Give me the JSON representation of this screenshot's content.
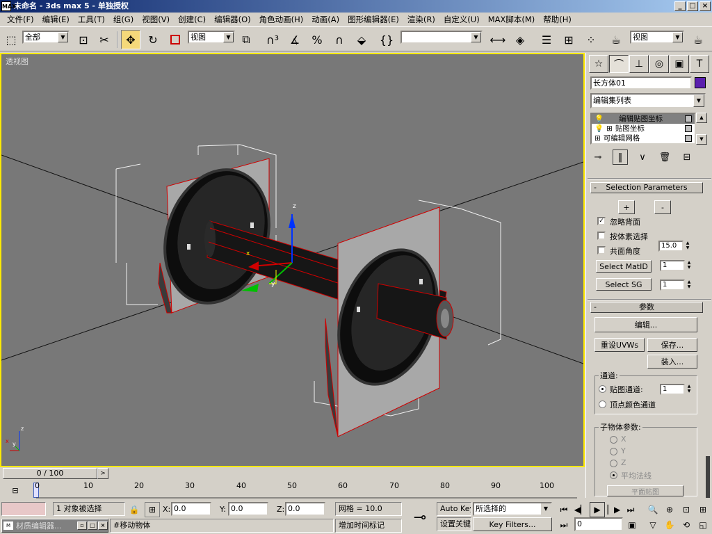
{
  "window": {
    "title": "未命名 - 3ds max 5 - 单独授权",
    "app_icon": "MAX"
  },
  "menu": [
    "文件(F)",
    "编辑(E)",
    "工具(T)",
    "组(G)",
    "视图(V)",
    "创建(C)",
    "编辑器(O)",
    "角色动画(H)",
    "动画(A)",
    "图形编辑器(E)",
    "渲染(R)",
    "自定义(U)",
    "MAX脚本(M)",
    "帮助(H)"
  ],
  "toolbar": {
    "selection_filter": "全部",
    "ref_coord": "视图",
    "named_selection": "",
    "render_view": "视图"
  },
  "viewport": {
    "label": "透视图",
    "gizmo_axis_z": "z",
    "gizmo_axis_x": "x",
    "gizmo_axis_y": "y",
    "corner_axis_z": "z",
    "corner_axis_x": "x",
    "corner_axis_y": "y"
  },
  "panel": {
    "object_name": "长方体01",
    "object_color": "#5a1fae",
    "modifier_list": "编辑集列表",
    "stack": [
      "编辑贴图坐标",
      "贴图坐标",
      "可编辑网格"
    ],
    "selection_params": {
      "title": "Selection Parameters",
      "plus": "+",
      "minus": "-",
      "ignore_backfacing": "忽略背面",
      "by_element": "按体素选择",
      "planar_angle": "共面角度",
      "planar_angle_value": "15.0",
      "select_matid": "Select MatID",
      "select_matid_value": "1",
      "select_sg": "Select SG",
      "select_sg_value": "1"
    },
    "params": {
      "title": "参数",
      "edit": "编辑...",
      "reset_uvws": "重设UVWs",
      "save": "保存...",
      "load": "装入...",
      "channel_group": "通道:",
      "map_channel": "贴图通道:",
      "map_channel_value": "1",
      "vertex_color_channel": "顶点颜色通道",
      "subobj_group": "子物体参数:",
      "axis_x": "X",
      "axis_y": "Y",
      "axis_z": "Z",
      "avg_normals": "平均法线",
      "cut_off": "平面贴图"
    }
  },
  "timeline": {
    "frame_display": "0 / 100",
    "ticks": [
      "0",
      "10",
      "20",
      "30",
      "40",
      "50",
      "60",
      "70",
      "80",
      "90",
      "100"
    ]
  },
  "status": {
    "selection_info": "1 对象被选择",
    "x_label": "X:",
    "x_value": "0.0",
    "y_label": "Y:",
    "y_value": "0.0",
    "z_label": "Z:",
    "z_value": "0.0",
    "grid": "网格 = 10.0",
    "prompt": "#移动物体",
    "add_time_tag": "增加时间标记",
    "auto_key": "Auto Key",
    "set_key": "设置关键帧",
    "key_mode": "所选择的",
    "key_filters": "Key Filters...",
    "current_frame": "0",
    "taskbar_item": "材质编辑器..."
  }
}
